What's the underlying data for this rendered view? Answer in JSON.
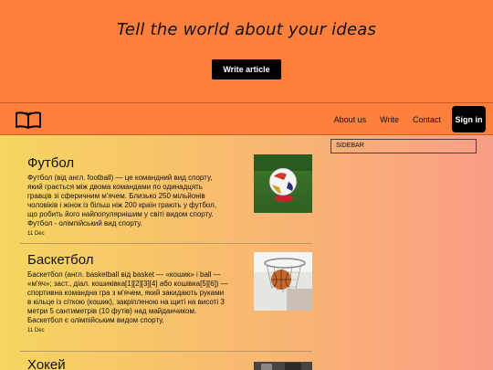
{
  "hero": {
    "title": "Tell the world about your ideas",
    "button_label": "Write article"
  },
  "nav": {
    "logo_icon": "open-book-icon",
    "links": [
      {
        "label": "About us"
      },
      {
        "label": "Write"
      },
      {
        "label": "Contact"
      }
    ],
    "signin_label": "Sign in"
  },
  "sidebar": {
    "label": "SIDEBAR"
  },
  "articles": [
    {
      "title": "Футбол",
      "text": "Футбол (від англ. football) — це командний вид спорту, який грається між двома командами по одинадцять гравців зі сферичним м'ячем. Близько 250 мільйонів чоловіків і жінок із більш ніж 200 країн грають у футбол, що робить його найпопулярнішим у світі видом спорту. Футбол - олімпійський вид спорту.",
      "date": "11 Dec",
      "image_icon": "soccer-ball-image"
    },
    {
      "title": "Баскетбол",
      "text": "Баскетбол (англ. basketball від basket — «кошик» і ball — «м'яч»; заст., діал. кошиківка[1][2][3][4] або кошівка[5][6]) — спортивна командна гра з м'ячем, який закидають руками в кільце із сіткою (кошик), закріпленою на щиті на висоті 3 метри 5 сантиметрів (10 футів) над майданчиком. Баскетбол є олімпійським видом спорту.",
      "date": "11 Dec",
      "image_icon": "basketball-hoop-image"
    },
    {
      "title": "Хокей",
      "text": "",
      "date": "",
      "image_icon": "hockey-image"
    }
  ],
  "colors": {
    "hero_bg": "#ff7f3d",
    "button_bg": "#000000",
    "gradient_start": "#f6d660",
    "gradient_end": "#fa9d86"
  }
}
